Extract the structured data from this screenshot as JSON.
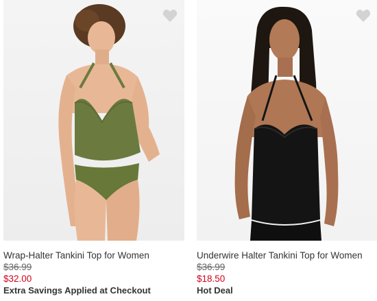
{
  "products": [
    {
      "name": "Wrap-Halter Tankini Top for Women",
      "original_price": "$36.99",
      "sale_price": "$32.00",
      "promo": "Extra Savings Applied at Checkout",
      "favorite_icon": "heart-icon",
      "swimsuit_color": "#6b7b3f"
    },
    {
      "name": "Underwire Halter Tankini Top for Women",
      "original_price": "$36.99",
      "sale_price": "$18.50",
      "promo": "Hot Deal",
      "favorite_icon": "heart-icon",
      "swimsuit_color": "#141414"
    }
  ],
  "colors": {
    "sale_price": "#d0021b",
    "text": "#333333",
    "heart": "#d3d3d3"
  }
}
